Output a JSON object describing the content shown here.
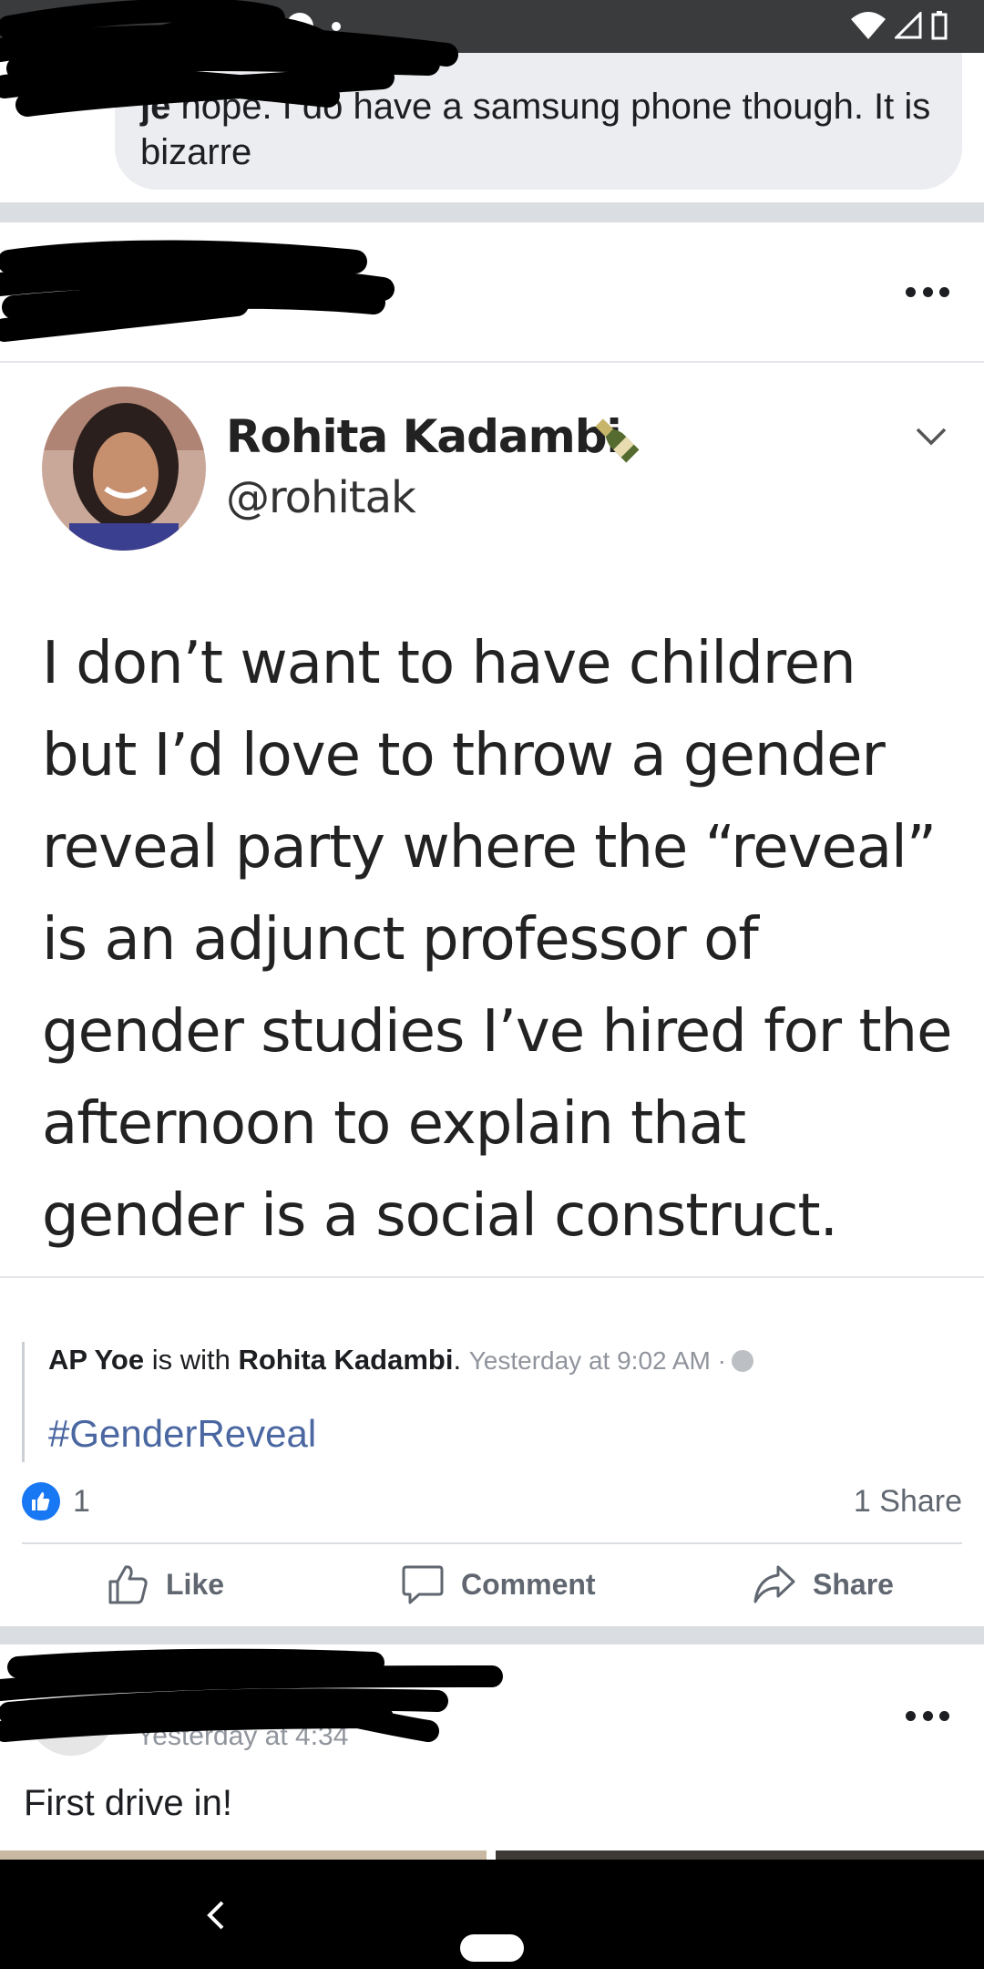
{
  "top_comment": {
    "author": "je",
    "text": " nope. I do have a samsung phone though. It is bizarre"
  },
  "tweet": {
    "name": "Rohita Kadambi",
    "handle": "@rohitak",
    "text": "I don’t want to have children but I’d love to throw a gender reveal party where the “reveal” is an adjunct professor of gender studies I’ve hired for the afternoon to explain that gender is a social construct."
  },
  "post": {
    "author": "AP Yoe",
    "with_text": " is with ",
    "tagged": "Rohita Kadambi",
    "period": ".",
    "timestamp": "Yesterday at 9:02 AM ·",
    "hashtag": "#GenderReveal",
    "like_count": "1",
    "share_count": "1 Share"
  },
  "actions": {
    "like": "Like",
    "comment": "Comment",
    "share": "Share"
  },
  "next_post": {
    "timestamp": "Yesterday at 4:34",
    "text": "First drive in!"
  },
  "colors": {
    "facebook_blue": "#1877f2",
    "hashtag": "#4b67a1",
    "gray_text": "#606770"
  }
}
